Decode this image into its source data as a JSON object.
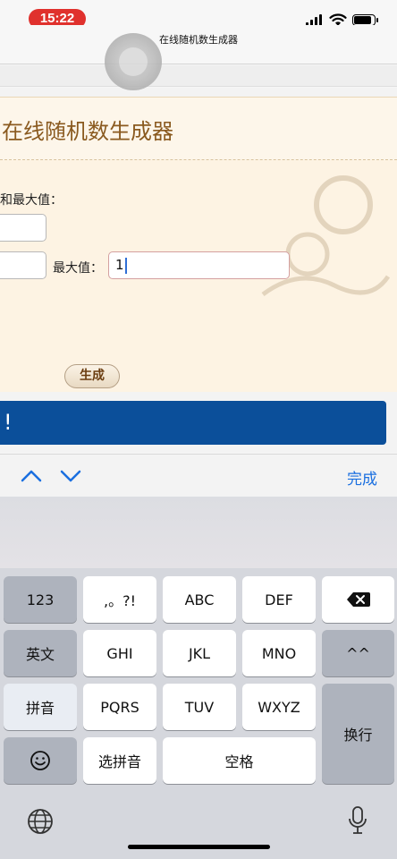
{
  "status_bar": {
    "time": "15:22"
  },
  "browser": {
    "page_title": "在线随机数生成器"
  },
  "page": {
    "title": "在线随机数生成器",
    "description": "和最大值：",
    "min_value_1": "",
    "min_value_2": "",
    "max_label": "最大值：",
    "max_value": "1",
    "generate_label": "生成",
    "result_text": "!"
  },
  "accessory_bar": {
    "done_label": "完成"
  },
  "keyboard": {
    "row1": [
      "123",
      ",。?!",
      "ABC",
      "DEF"
    ],
    "row2": [
      "英文",
      "GHI",
      "JKL",
      "MNO",
      "^^"
    ],
    "row3": [
      "拼音",
      "PQRS",
      "TUV",
      "WXYZ"
    ],
    "enter_label": "换行",
    "pinyin_select_label": "选拼音",
    "space_label": "空格"
  },
  "colors": {
    "time_pill": "#e0312d",
    "title_text": "#8a5a1f",
    "result_bar": "#0b4f9a",
    "accent": "#1a6fe0"
  },
  "icons": [
    "signal-icon",
    "wifi-icon",
    "battery-icon",
    "chevron-up-icon",
    "chevron-down-icon",
    "backspace-icon",
    "emoji-icon",
    "globe-icon",
    "microphone-icon"
  ]
}
